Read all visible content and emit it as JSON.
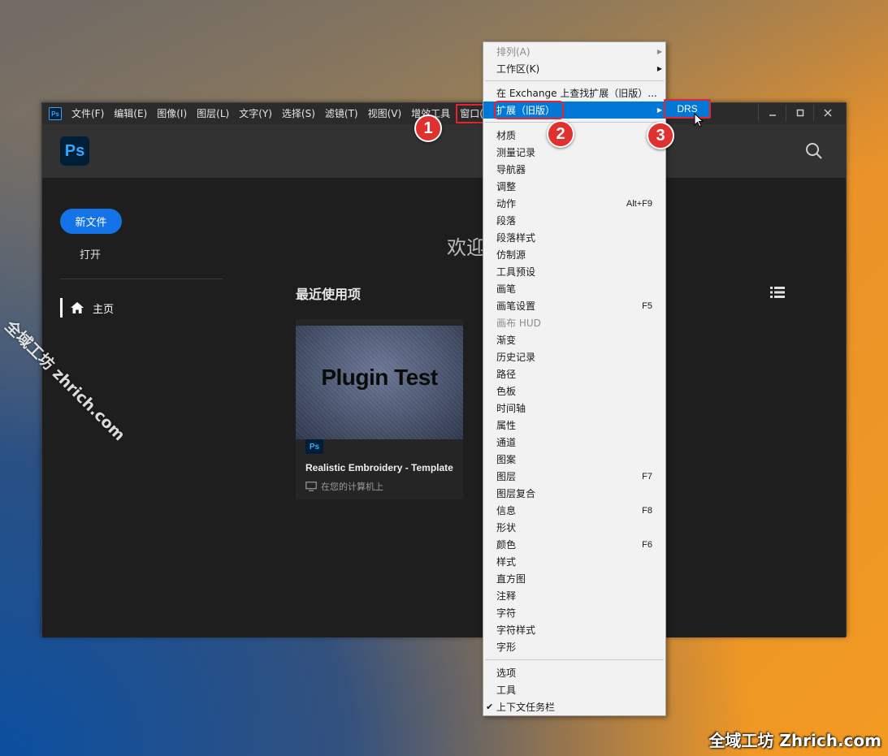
{
  "menubar": {
    "items": [
      {
        "label": "文件(F)"
      },
      {
        "label": "编辑(E)"
      },
      {
        "label": "图像(I)"
      },
      {
        "label": "图层(L)"
      },
      {
        "label": "文字(Y)"
      },
      {
        "label": "选择(S)"
      },
      {
        "label": "滤镜(T)"
      },
      {
        "label": "视图(V)"
      },
      {
        "label": "增效工具"
      },
      {
        "label": "窗口(W)"
      }
    ]
  },
  "app": {
    "logo_text": "Ps",
    "new_file": "新文件",
    "open": "打开",
    "home": "主页",
    "welcome": "欢迎",
    "recent_title": "最近使用项",
    "card": {
      "thumb_text": "Plugin Test",
      "badge": "Ps",
      "title": "Realistic Embroidery - Template",
      "location": "在您的计算机上"
    }
  },
  "window_menu": {
    "items": [
      {
        "label": "排列(A)",
        "shortcut": "",
        "submenu": true,
        "disabled": true
      },
      {
        "label": "工作区(K)",
        "shortcut": "",
        "submenu": true
      },
      {
        "label": "在 Exchange 上查找扩展（旧版）...",
        "shortcut": ""
      },
      {
        "label": "扩展（旧版）",
        "shortcut": "",
        "submenu": true,
        "selected": true
      },
      {
        "label": "材质",
        "shortcut": ""
      },
      {
        "label": "测量记录",
        "shortcut": ""
      },
      {
        "label": "导航器",
        "shortcut": ""
      },
      {
        "label": "调整",
        "shortcut": ""
      },
      {
        "label": "动作",
        "shortcut": "Alt+F9"
      },
      {
        "label": "段落",
        "shortcut": ""
      },
      {
        "label": "段落样式",
        "shortcut": ""
      },
      {
        "label": "仿制源",
        "shortcut": ""
      },
      {
        "label": "工具预设",
        "shortcut": ""
      },
      {
        "label": "画笔",
        "shortcut": ""
      },
      {
        "label": "画笔设置",
        "shortcut": "F5"
      },
      {
        "label": "画布 HUD",
        "shortcut": "",
        "disabled": true
      },
      {
        "label": "渐变",
        "shortcut": ""
      },
      {
        "label": "历史记录",
        "shortcut": ""
      },
      {
        "label": "路径",
        "shortcut": ""
      },
      {
        "label": "色板",
        "shortcut": ""
      },
      {
        "label": "时间轴",
        "shortcut": ""
      },
      {
        "label": "属性",
        "shortcut": ""
      },
      {
        "label": "通道",
        "shortcut": ""
      },
      {
        "label": "图案",
        "shortcut": ""
      },
      {
        "label": "图层",
        "shortcut": "F7"
      },
      {
        "label": "图层复合",
        "shortcut": ""
      },
      {
        "label": "信息",
        "shortcut": "F8"
      },
      {
        "label": "形状",
        "shortcut": ""
      },
      {
        "label": "颜色",
        "shortcut": "F6"
      },
      {
        "label": "样式",
        "shortcut": ""
      },
      {
        "label": "直方图",
        "shortcut": ""
      },
      {
        "label": "注释",
        "shortcut": ""
      },
      {
        "label": "字符",
        "shortcut": ""
      },
      {
        "label": "字符样式",
        "shortcut": ""
      },
      {
        "label": "字形",
        "shortcut": ""
      },
      {
        "label": "选项",
        "shortcut": ""
      },
      {
        "label": "工具",
        "shortcut": ""
      },
      {
        "label": "上下文任务栏",
        "shortcut": "",
        "checked": true
      }
    ]
  },
  "submenu": {
    "label": "DRS"
  },
  "step_badges": [
    "1",
    "2",
    "3"
  ],
  "watermark": {
    "diagonal": "全域工坊 zhrich.com",
    "corner": "全域工坊 Zhrich.com"
  },
  "colors": {
    "accent_blue": "#1473e6",
    "menu_highlight": "#0078d7",
    "annotation_red": "#e8232e",
    "ps_blue": "#31a8ff",
    "ps_dark": "#001e36"
  }
}
